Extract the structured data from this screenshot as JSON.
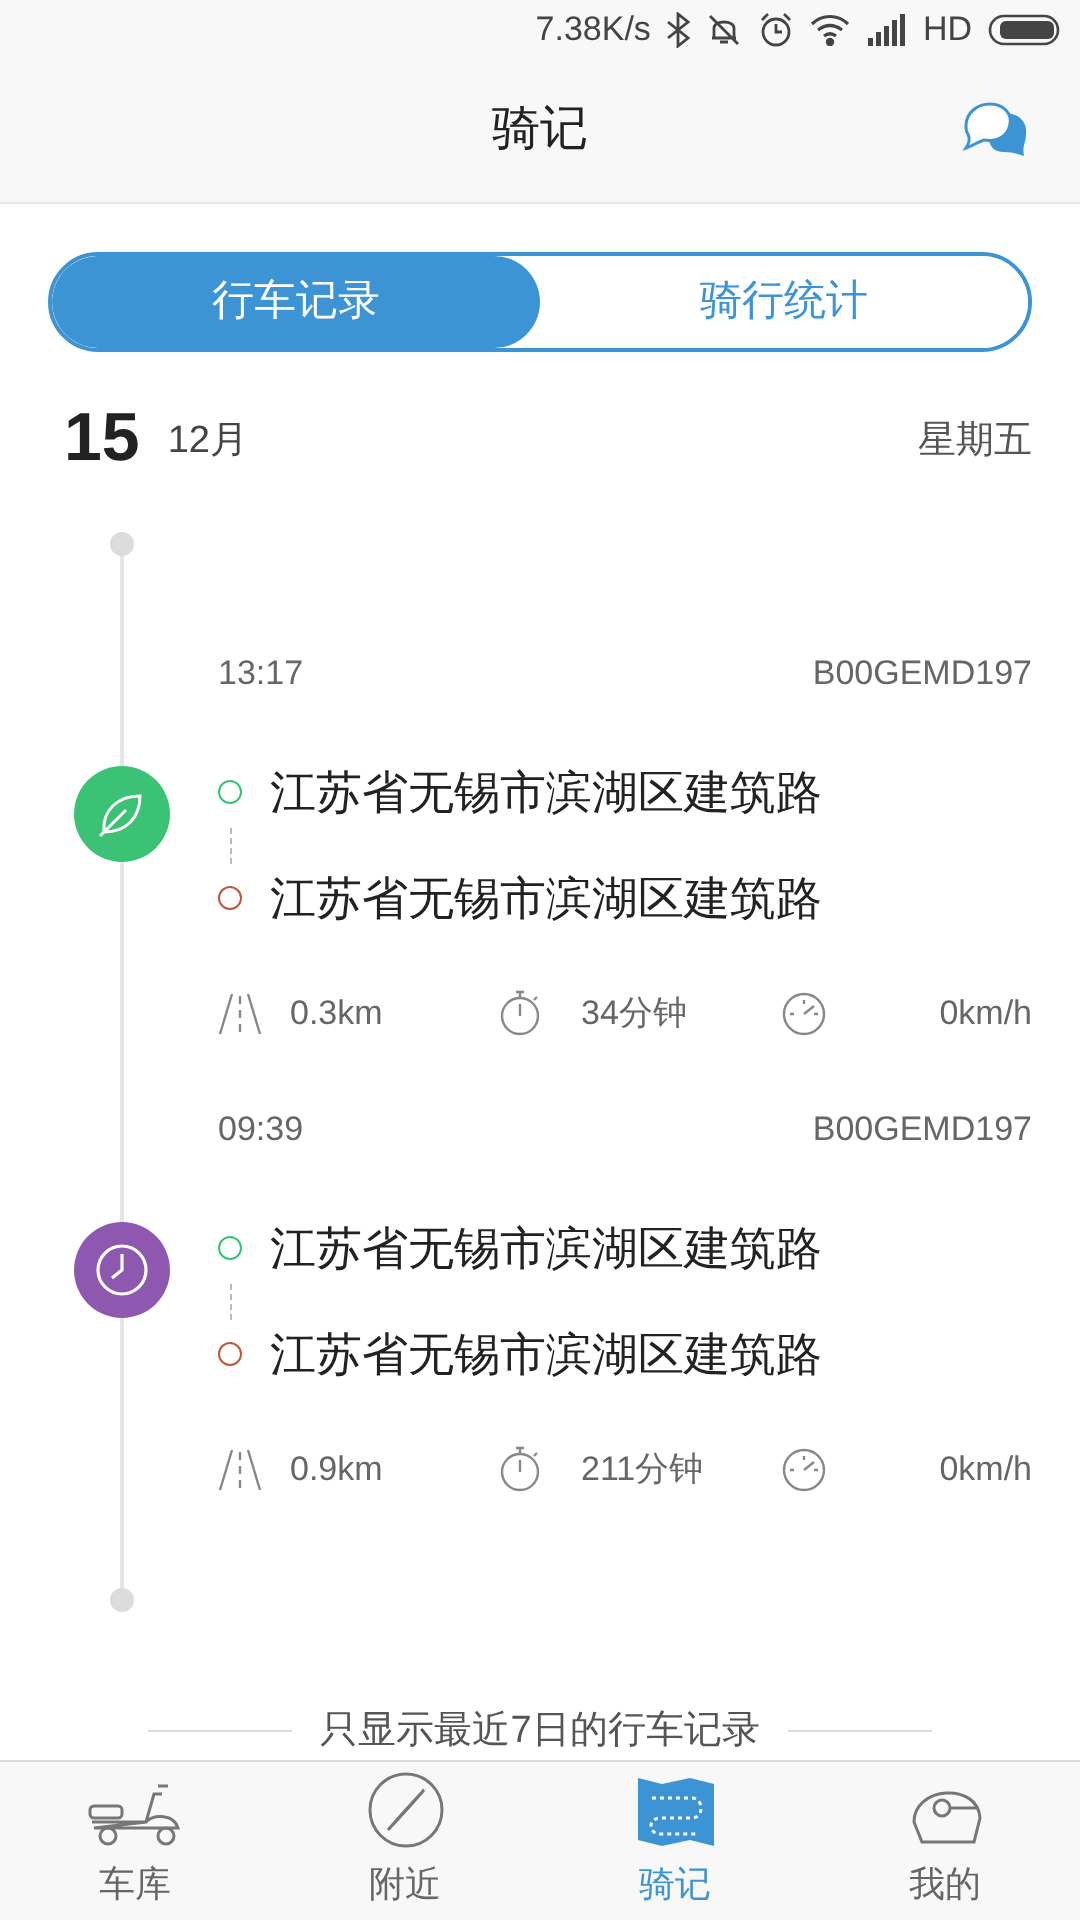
{
  "status_bar": {
    "speed": "7.38K/s",
    "network": "HD"
  },
  "header": {
    "title": "骑记"
  },
  "segments": [
    {
      "label": "行车记录",
      "selected": true
    },
    {
      "label": "骑行统计",
      "selected": false
    }
  ],
  "day": {
    "date": "15",
    "month": "12月",
    "weekday": "星期五"
  },
  "trips": [
    {
      "time": "13:17",
      "vehicle": "B00GEMD197",
      "kind": "leaf",
      "color": "#3cc274",
      "start": "江苏省无锡市滨湖区建筑路",
      "end": "江苏省无锡市滨湖区建筑路",
      "distance": "0.3km",
      "duration": "34分钟",
      "speed": "0km/h"
    },
    {
      "time": "09:39",
      "vehicle": "B00GEMD197",
      "kind": "clock",
      "color": "#8e58b0",
      "start": "江苏省无锡市滨湖区建筑路",
      "end": "江苏省无锡市滨湖区建筑路",
      "distance": "0.9km",
      "duration": "211分钟",
      "speed": "0km/h"
    }
  ],
  "footer_note": "只显示最近7日的行车记录",
  "tab_bar": [
    {
      "label": "车库",
      "kind": "scooter",
      "selected": false
    },
    {
      "label": "附近",
      "kind": "compass",
      "selected": false
    },
    {
      "label": "骑记",
      "kind": "map",
      "selected": true
    },
    {
      "label": "我的",
      "kind": "helmet",
      "selected": false
    }
  ]
}
